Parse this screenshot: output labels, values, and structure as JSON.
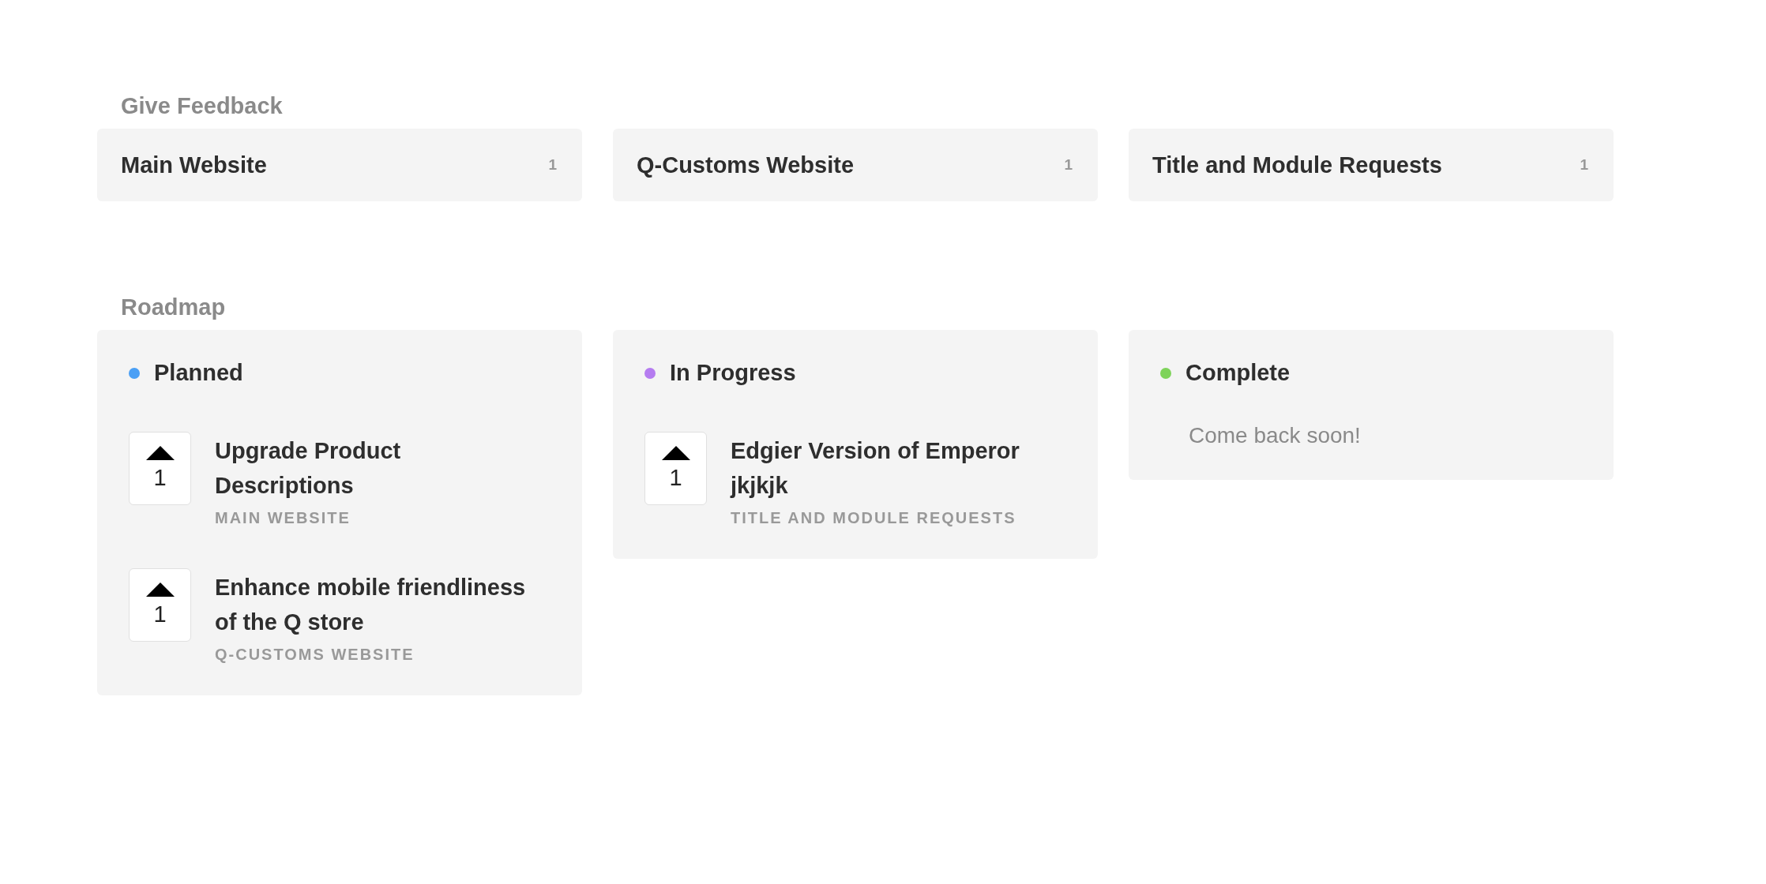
{
  "feedback": {
    "heading": "Give Feedback",
    "boards": [
      {
        "name": "Main Website",
        "count": "1"
      },
      {
        "name": "Q-Customs Website",
        "count": "1"
      },
      {
        "name": "Title and Module Requests",
        "count": "1"
      }
    ]
  },
  "roadmap": {
    "heading": "Roadmap",
    "columns": [
      {
        "title": "Planned",
        "color": "#4a9ff5",
        "items": [
          {
            "title": "Upgrade Product Descriptions",
            "board": "MAIN WEBSITE",
            "votes": "1"
          },
          {
            "title": "Enhance mobile friendliness of the Q store",
            "board": "Q-CUSTOMS WEBSITE",
            "votes": "1"
          }
        ]
      },
      {
        "title": "In Progress",
        "color": "#b57cf0",
        "items": [
          {
            "title": "Edgier Version of Emperor jkjkjk",
            "board": "TITLE AND MODULE REQUESTS",
            "votes": "1"
          }
        ]
      },
      {
        "title": "Complete",
        "color": "#7ed35a",
        "empty_text": "Come back soon!"
      }
    ]
  }
}
